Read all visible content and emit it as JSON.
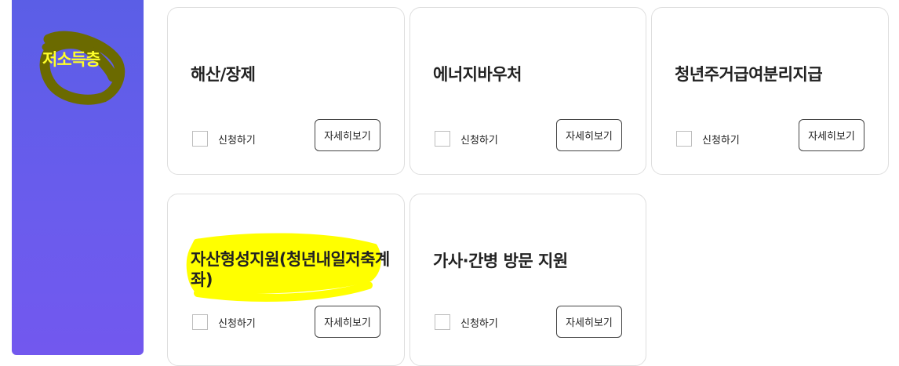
{
  "category": {
    "title": "저소득층",
    "annotation_color": "#6b6a00",
    "highlight_text_color": "#ffff2a"
  },
  "cards": [
    {
      "title": "해산/장제",
      "apply_label": "신청하기",
      "detail_label": "자세히보기"
    },
    {
      "title": "에너지바우처",
      "apply_label": "신청하기",
      "detail_label": "자세히보기"
    },
    {
      "title": "청년주거급여분리지급",
      "apply_label": "신청하기",
      "detail_label": "자세히보기"
    },
    {
      "title": "자산형성지원(청년내일저축계좌)",
      "apply_label": "신청하기",
      "detail_label": "자세히보기",
      "highlighted": true,
      "highlight_color": "#ffff00"
    },
    {
      "title": "가사·간병 방문 지원",
      "apply_label": "신청하기",
      "detail_label": "자세히보기"
    }
  ]
}
